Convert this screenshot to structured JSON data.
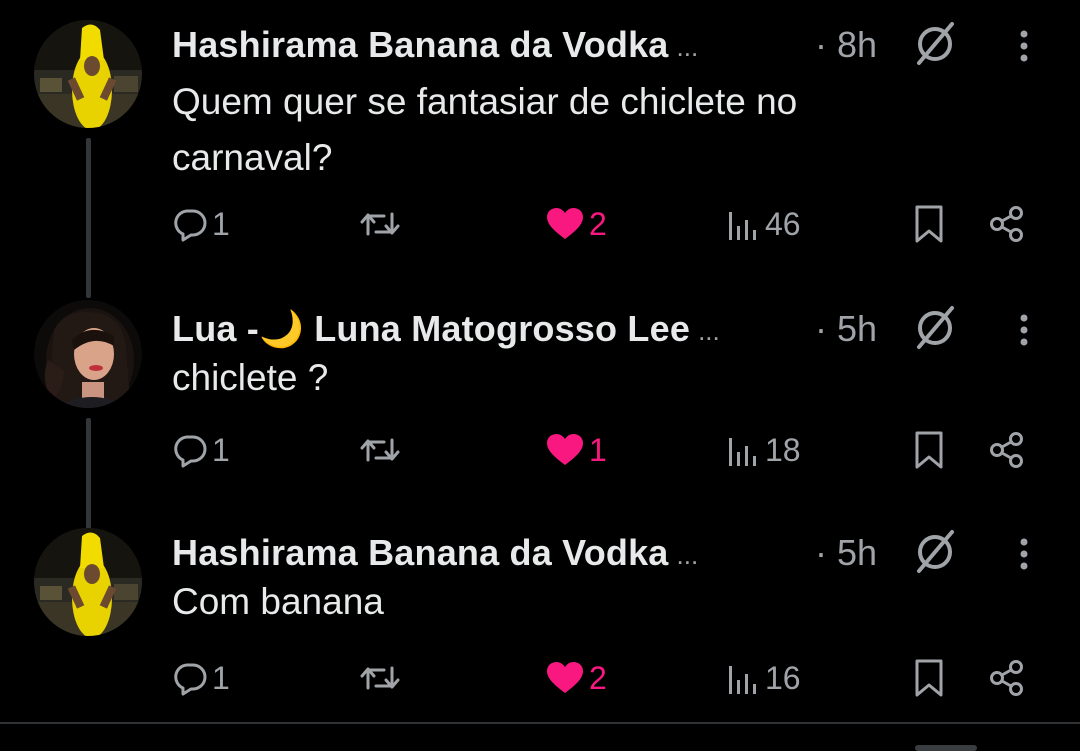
{
  "colors": {
    "background": "#000000",
    "text_primary": "#e7e9ea",
    "text_secondary": "#a0a4a8",
    "like_active": "#f91880",
    "thread_line": "#333639"
  },
  "tweets": [
    {
      "author": "Hashirama Banana da Vodka",
      "truncation": "...",
      "time": "· 8h",
      "text": "Quem quer se fantasiar de chiclete no carnaval?",
      "avatar": "banana-costume-avatar",
      "verified_icon": "unavailable-badge-icon",
      "replies": "1",
      "retweets": "",
      "likes": "2",
      "liked": true,
      "views": "46"
    },
    {
      "author": "Lua -🌙 Luna Matogrosso Lee",
      "truncation": "...",
      "time": "· 5h",
      "text": "chiclete ?",
      "avatar": "woman-portrait-avatar",
      "verified_icon": "unavailable-badge-icon",
      "replies": "1",
      "retweets": "",
      "likes": "1",
      "liked": true,
      "views": "18"
    },
    {
      "author": "Hashirama Banana da Vodka",
      "truncation": "...",
      "time": "· 5h",
      "text": "Com banana",
      "avatar": "banana-costume-avatar",
      "verified_icon": "unavailable-badge-icon",
      "replies": "1",
      "retweets": "",
      "likes": "2",
      "liked": true,
      "views": "16"
    }
  ]
}
